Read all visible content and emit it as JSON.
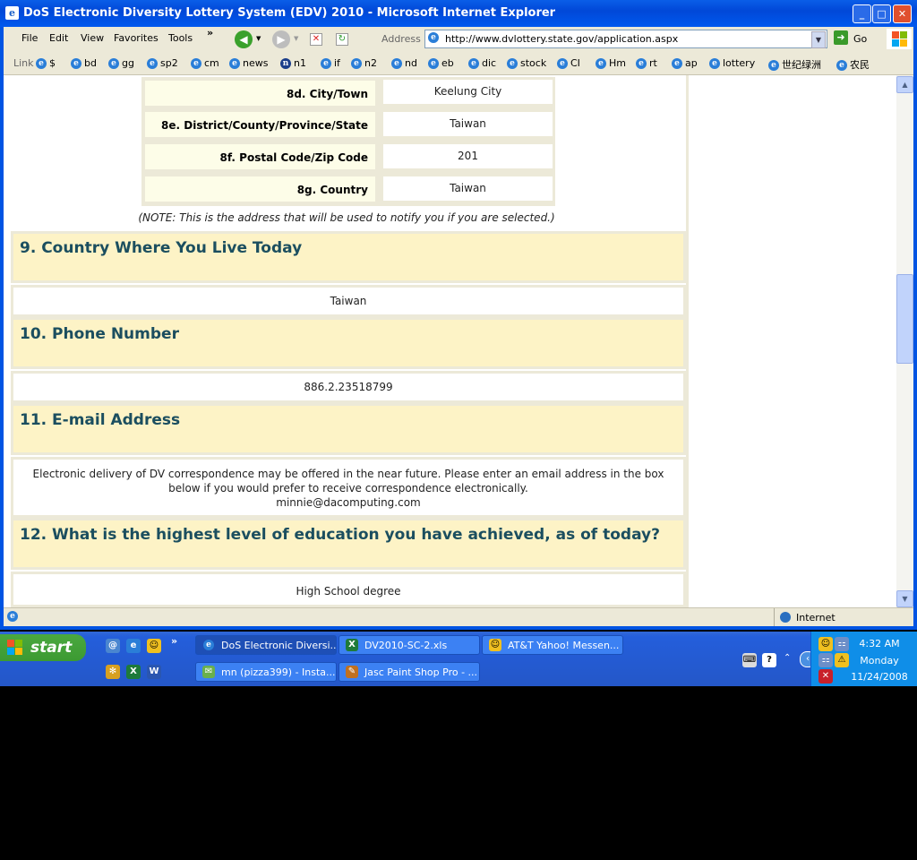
{
  "window": {
    "title": "DoS Electronic Diversity Lottery System (EDV) 2010 - Microsoft Internet Explorer",
    "controls": {
      "minimize": "_",
      "maximize": "□",
      "close": "✕"
    }
  },
  "menu": [
    "File",
    "Edit",
    "View",
    "Favorites",
    "Tools"
  ],
  "toolbar": {
    "more": "»",
    "address_label": "Address",
    "url": "http://www.dvlottery.state.gov/application.aspx",
    "go_label": "Go"
  },
  "links_label": "Link",
  "links": [
    "$",
    "bd",
    "gg",
    "sp2",
    "cm",
    "news",
    "n1",
    "if",
    "n2",
    "nd",
    "eb",
    "dic",
    "stock",
    "CI",
    "Hm",
    "rt",
    "ap",
    "lottery",
    "世纪绿洲",
    "农民"
  ],
  "address_rows": [
    {
      "label": "8d. City/Town",
      "value": "Keelung City"
    },
    {
      "label": "8e. District/County/Province/State",
      "value": "Taiwan"
    },
    {
      "label": "8f. Postal Code/Zip Code",
      "value": "201"
    },
    {
      "label": "8g. Country",
      "value": "Taiwan"
    }
  ],
  "address_note": "(NOTE: This is the address that will be used to notify you if you are selected.)",
  "sections": {
    "q9": {
      "heading": "9. Country Where You Live Today",
      "answer": "Taiwan"
    },
    "q10": {
      "heading": "10. Phone Number",
      "answer": "886.2.23518799"
    },
    "q11": {
      "heading": "11. E-mail Address",
      "info": "Electronic delivery of DV correspondence may be offered in the near future. Please enter an email address in the box below if you would prefer to receive correspondence electronically.",
      "answer": "minnie@dacomputing.com"
    },
    "q12": {
      "heading": "12. What is the highest level of education you have achieved, as of today?",
      "answer": "High School degree"
    }
  },
  "status": {
    "zone": "Internet"
  },
  "taskbar": {
    "start": "start",
    "tasks_row1": [
      "DoS Electronic Diversi...",
      "DV2010-SC-2.xls",
      "AT&T Yahoo! Messen..."
    ],
    "tasks_row2": [
      "mn (pizza399) - Insta...",
      "Jasc Paint Shop Pro - ..."
    ],
    "clock": {
      "time": "4:32 AM",
      "day": "Monday",
      "date": "11/24/2008"
    }
  }
}
